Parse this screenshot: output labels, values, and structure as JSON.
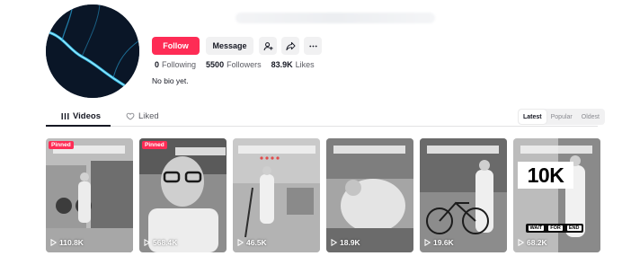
{
  "profile": {
    "follow_label": "Follow",
    "message_label": "Message",
    "bio": "No bio yet."
  },
  "stats": [
    {
      "value": "0",
      "label": "Following"
    },
    {
      "value": "5500",
      "label": "Followers"
    },
    {
      "value": "83.9K",
      "label": "Likes"
    }
  ],
  "icons": {
    "add_friend": "add-user-icon",
    "share": "share-icon",
    "more": "more-dots-icon"
  },
  "tabs": [
    {
      "label": "Videos",
      "icon": "grid-icon",
      "active": true
    },
    {
      "label": "Liked",
      "icon": "heart-lock-icon",
      "active": false
    }
  ],
  "sort": [
    {
      "label": "Latest",
      "active": true
    },
    {
      "label": "Popular",
      "active": false
    },
    {
      "label": "Oldest",
      "active": false
    }
  ],
  "videos": [
    {
      "views": "110.8K",
      "pinned": "Pinned"
    },
    {
      "views": "568.4K",
      "pinned": "Pinned"
    },
    {
      "views": "46.5K"
    },
    {
      "views": "18.9K"
    },
    {
      "views": "19.6K"
    },
    {
      "views": "68.2K",
      "overlay": "10K",
      "tag": [
        "WAIT",
        "FOR",
        "END"
      ]
    }
  ],
  "colors": {
    "accent": "#fe2c55",
    "text": "#161823",
    "muted": "#5a5b62"
  }
}
